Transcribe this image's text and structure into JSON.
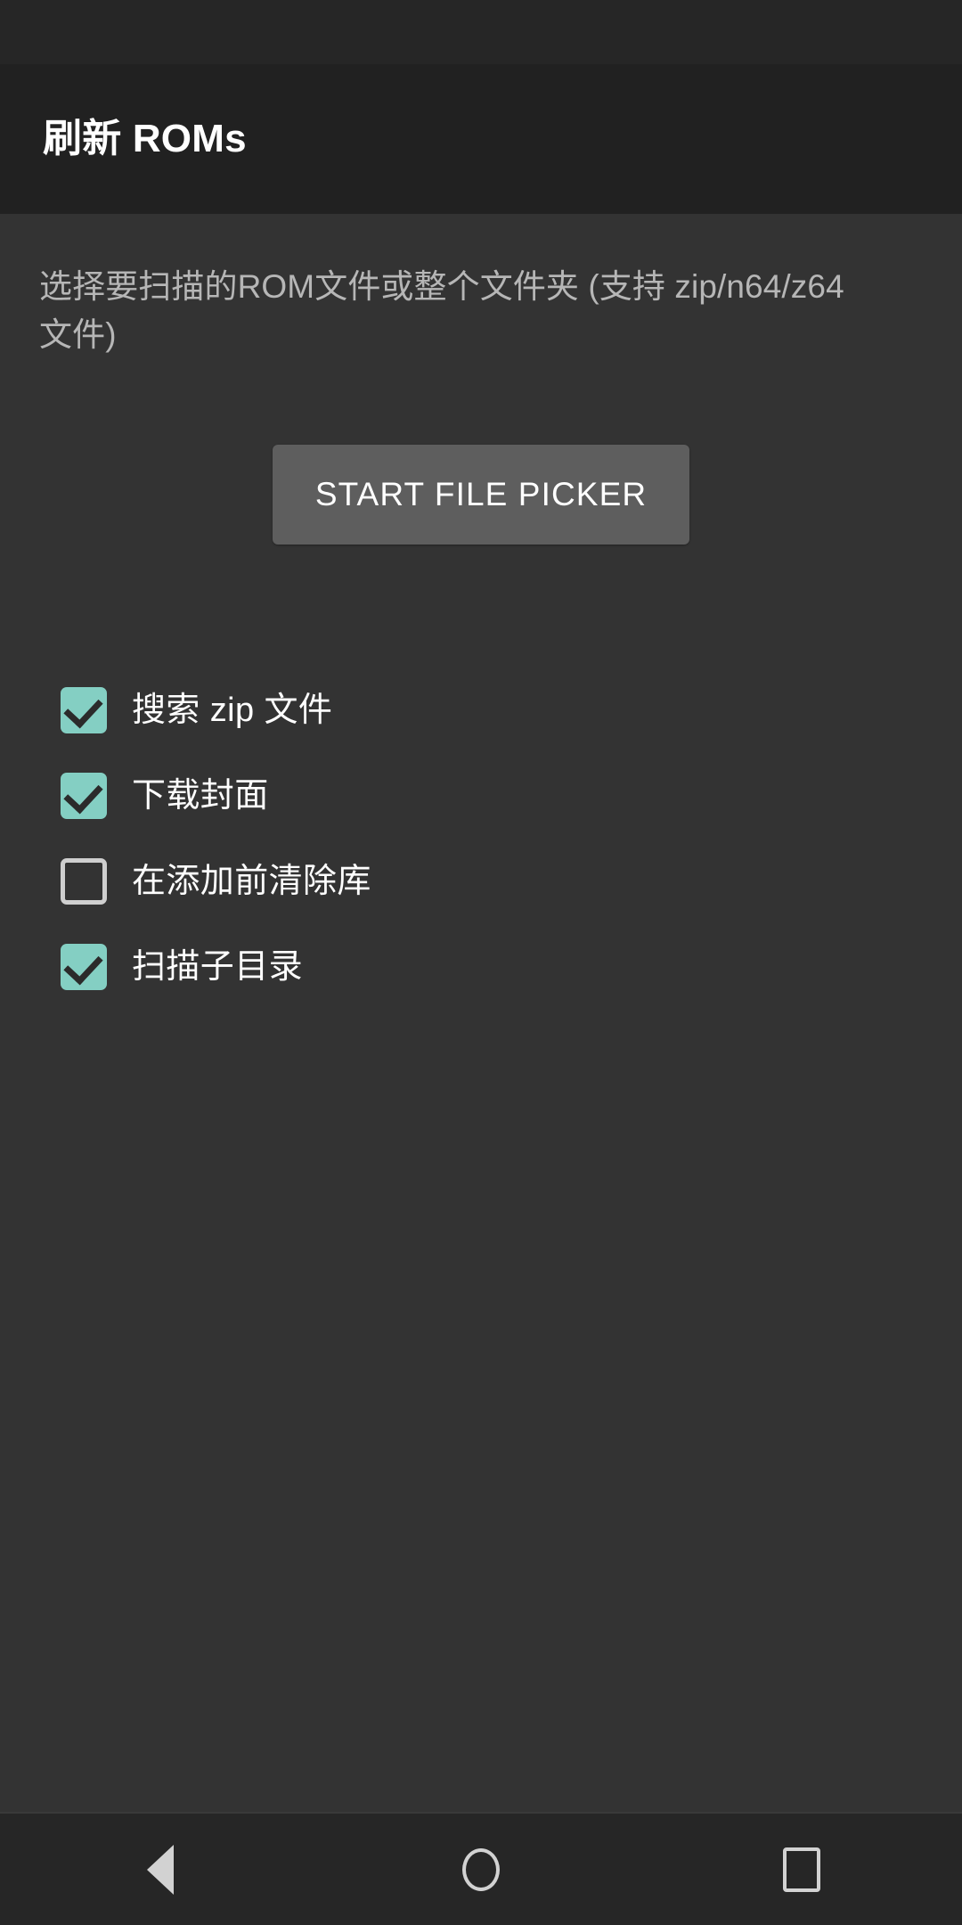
{
  "status_bar": {
    "visible": true
  },
  "app_bar": {
    "title": "刷新 ROMs"
  },
  "main": {
    "description": "选择要扫描的ROM文件或整个文件夹 (支持 zip/n64/z64 文件)",
    "picker_button_label": "START FILE PICKER",
    "options": [
      {
        "label": "搜索 zip 文件",
        "checked": true
      },
      {
        "label": "下载封面",
        "checked": true
      },
      {
        "label": "在添加前清除库",
        "checked": false
      },
      {
        "label": "扫描子目录",
        "checked": true
      }
    ]
  },
  "nav_bar": {
    "back_label": "Back",
    "home_label": "Home",
    "recents_label": "Recents"
  },
  "colors": {
    "status_bar_bg": "#262626",
    "app_bar_bg": "#212121",
    "content_bg": "#333333",
    "accent_checkbox": "#84cfc3",
    "button_bg": "#5e5e5e",
    "title_text": "#ffffff",
    "description_text": "#b6b6b6",
    "label_text": "#ffffff",
    "nav_icon": "#d2d2d2"
  }
}
